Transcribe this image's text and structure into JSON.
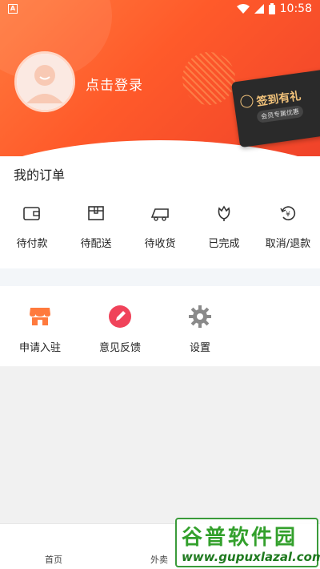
{
  "status_bar": {
    "time": "10:58",
    "notification_glyph": "A"
  },
  "profile": {
    "login_text": "点击登录"
  },
  "sign_in_card": {
    "title": "签到有礼",
    "subtitle": "会员专属优惠"
  },
  "orders": {
    "title": "我的订单",
    "items": [
      {
        "label": "待付款",
        "icon": "wallet-icon"
      },
      {
        "label": "待配送",
        "icon": "box-icon"
      },
      {
        "label": "待收货",
        "icon": "truck-icon"
      },
      {
        "label": "已完成",
        "icon": "flower-icon"
      },
      {
        "label": "取消/退款",
        "icon": "refund-icon"
      }
    ]
  },
  "tools": {
    "items": [
      {
        "label": "申请入驻",
        "icon": "store-icon",
        "color": "#ff7a3d"
      },
      {
        "label": "意见反馈",
        "icon": "pencil-icon",
        "color": "#f0435a"
      },
      {
        "label": "设置",
        "icon": "gear-icon",
        "color": "#8a8a8a"
      }
    ]
  },
  "bottom_nav": {
    "items": [
      {
        "label": "首页"
      },
      {
        "label": "外卖"
      }
    ]
  },
  "watermark": {
    "brand": "谷普软件园",
    "url": "www.gupuxlazal.com"
  },
  "colors": {
    "accent": "#ff5a2a",
    "card_gold": "#f1c27a"
  }
}
